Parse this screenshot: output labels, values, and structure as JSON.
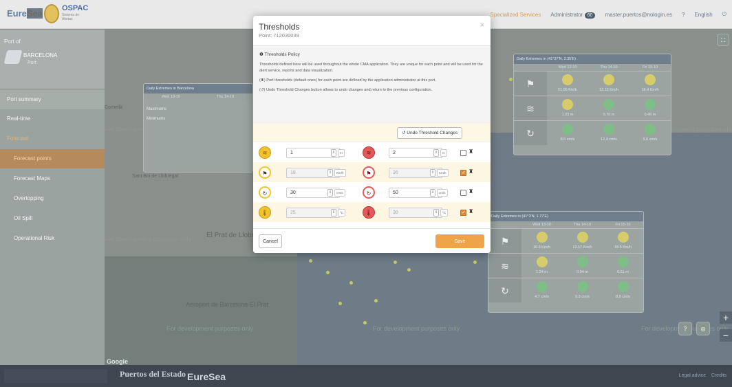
{
  "header": {
    "brand_prefix": "Eure",
    "brand_suffix": "Sea",
    "ospac": "OSPAC",
    "ospac_sub": "Sistema de Alertas",
    "specialized_services": "Specialized Services",
    "administrator": "Administrator",
    "admin_badge": "60",
    "user_email": "master.puertos@nologin.es",
    "help": "?",
    "language": "English",
    "power_icon": "power-icon"
  },
  "sidebar": {
    "port_of_label": "Port of",
    "port_name": "BARCELONA",
    "port_kind": "Port",
    "items": [
      {
        "label": "Port summary"
      },
      {
        "label": "Real-time"
      },
      {
        "label": "Forecast"
      },
      {
        "label": "Forecast points"
      },
      {
        "label": "Forecast Maps"
      },
      {
        "label": "Overtopping"
      },
      {
        "label": "Oil Spill"
      },
      {
        "label": "Operational Risk"
      }
    ]
  },
  "map": {
    "watermark": "For development purposes only",
    "google": "Google",
    "place_prat": "El Prat de Llobregat",
    "place_airport": "Aeroport de Barcelona-El Prat",
    "place_sant_boi": "Sant Boi de Llobregat",
    "place_cornella": "Cornellà",
    "panel_a_title": "Daily Extremes in Barcelona",
    "panel_b_title": "Daily Extremes in (41°37'N, 2.35'E)",
    "panel_c_title": "Daily Extremes in (41°3'N, 1.77'E)",
    "days": [
      "Wed 13-10",
      "Thu 14-10",
      "Fri 15-10"
    ],
    "panel_b_rows": [
      [
        "21.06 Km/h",
        "12.13 Km/h",
        "18.4 Km/h"
      ],
      [
        "1.03 m",
        "0.70 m",
        "0.46 m"
      ],
      [
        "8.5 cm/s",
        "12.4 cm/s",
        "9.0 cm/s"
      ]
    ],
    "panel_c_rows": [
      [
        "16.9 Km/h",
        "13.57 Km/h",
        "18.5 Km/h"
      ],
      [
        "1.24 m",
        "0.94 m",
        "0.51 m"
      ],
      [
        "4.7 cm/s",
        "9.3 cm/s",
        "8.9 cm/s"
      ]
    ],
    "panel_a_label_max": "Maximums",
    "panel_a_label_min": "Minimums"
  },
  "dialog": {
    "title": "Thresholds",
    "subtitle": "Point: 712030039",
    "close": "×",
    "policy_title": "Thresholds Policy",
    "policy_p1": "Thresholds defined here will be used throughout the whole CMA application. They are unique for each point and will be used for the alert service, reports and data visualization.",
    "policy_p2": "Port thresholds (default ones) for each point are defined by the application administrator at this port.",
    "policy_p3": "Undo Threshold Changes button allows to undo changes and return to the previous configuration.",
    "undo_label": "Undo Threshold Changes",
    "rows": [
      {
        "low_value": "1",
        "low_unit": "m",
        "high_value": "2",
        "high_unit": "m",
        "checked": false,
        "low_disabled": false,
        "high_disabled": false
      },
      {
        "low_value": "18",
        "low_unit": "Km/h",
        "high_value": "36",
        "high_unit": "Km/h",
        "checked": true,
        "low_disabled": true,
        "high_disabled": true
      },
      {
        "low_value": "30",
        "low_unit": "cm/s",
        "high_value": "50",
        "high_unit": "cm/s",
        "checked": false,
        "low_disabled": false,
        "high_disabled": false
      },
      {
        "low_value": "25",
        "low_unit": "ºC",
        "high_value": "30",
        "high_unit": "ºC",
        "checked": true,
        "low_disabled": true,
        "high_disabled": true
      }
    ],
    "cancel_label": "Cancel",
    "save_label": "Save"
  },
  "footer": {
    "puertos": "Puertos del Estado",
    "euresea": "EureSea",
    "legal": "Legal advice",
    "credits": "Credits"
  },
  "colors": {
    "accent": "#f0a44a",
    "warn_yellow": "#f2c230",
    "alert_red": "#e35a5a"
  }
}
